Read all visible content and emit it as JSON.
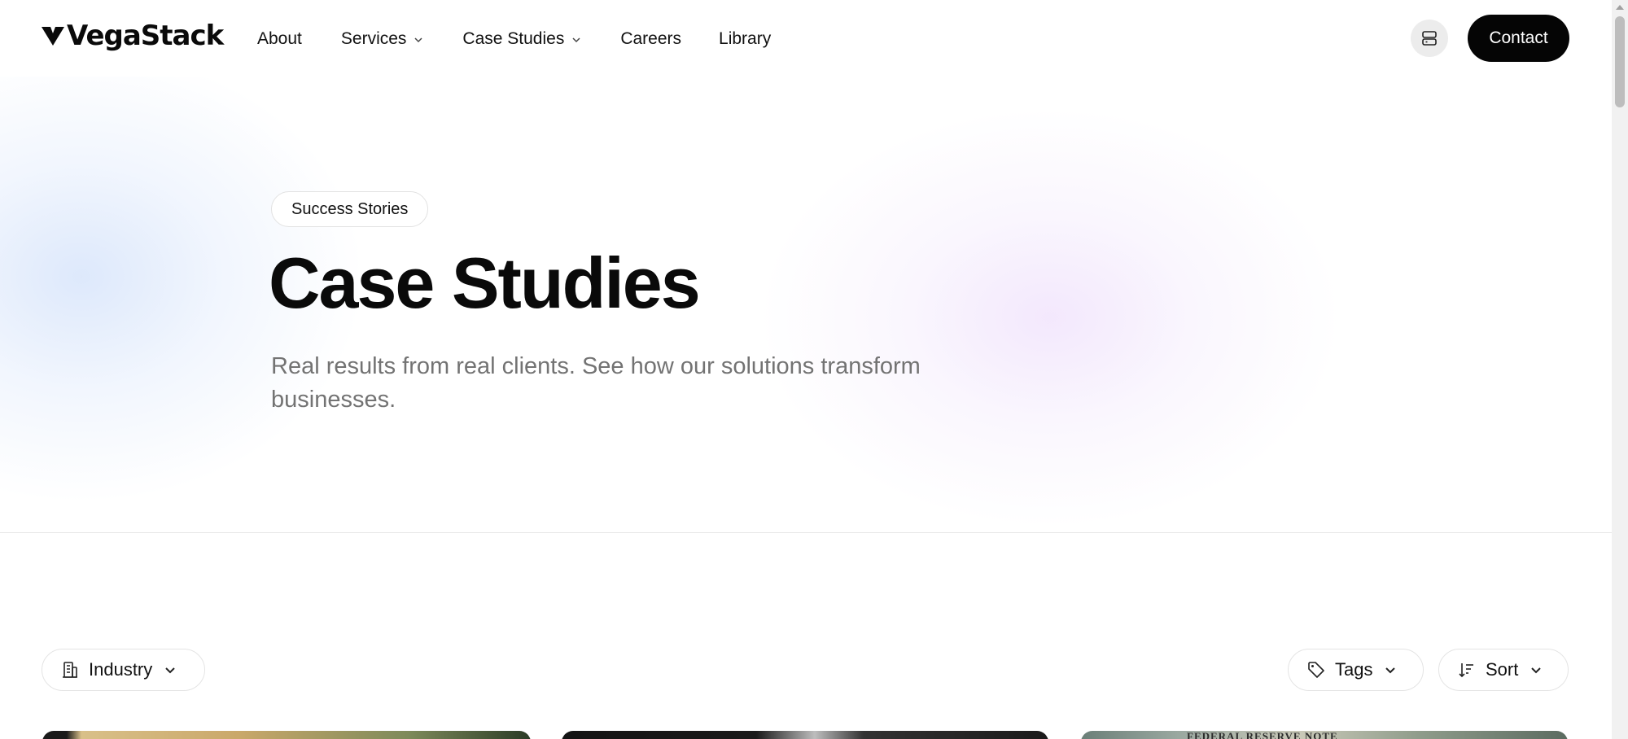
{
  "header": {
    "logo": "VegaStack",
    "nav": [
      {
        "label": "About",
        "has_dropdown": false
      },
      {
        "label": "Services",
        "has_dropdown": true
      },
      {
        "label": "Case Studies",
        "has_dropdown": true
      },
      {
        "label": "Careers",
        "has_dropdown": false
      },
      {
        "label": "Library",
        "has_dropdown": false
      }
    ],
    "icon_button": "server-icon",
    "contact_label": "Contact"
  },
  "hero": {
    "badge": "Success Stories",
    "title": "Case Studies",
    "subtitle": "Real results from real clients. See how our solutions transform businesses."
  },
  "filters": {
    "industry_label": "Industry",
    "tags_label": "Tags",
    "sort_label": "Sort"
  },
  "cards": [
    {
      "image": "case-study-image-1"
    },
    {
      "image": "case-study-image-2"
    },
    {
      "image": "case-study-image-3",
      "visible_text": "FEDERAL RESERVE NOTE"
    }
  ],
  "colors": {
    "primary_button": "#050505",
    "muted_text": "#737373",
    "border": "#e4e4e4"
  }
}
